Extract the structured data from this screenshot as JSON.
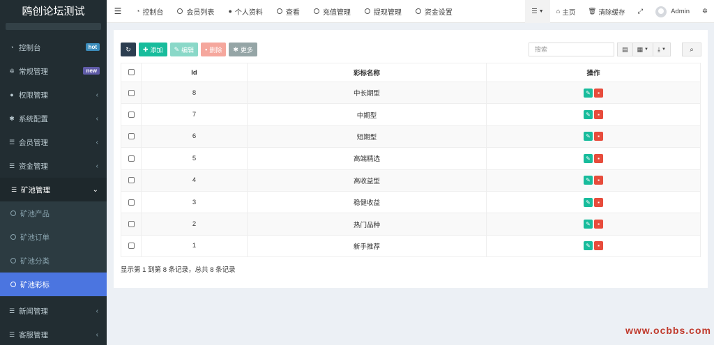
{
  "app": {
    "title": "鸥创论坛测试"
  },
  "sidebar": {
    "items": [
      {
        "label": "控制台",
        "icon": "dashboard-icon",
        "badge": "hot"
      },
      {
        "label": "常规管理",
        "icon": "cogs-icon",
        "badge": "new"
      },
      {
        "label": "权限管理",
        "icon": "group-icon",
        "arrow": "‹"
      },
      {
        "label": "系统配置",
        "icon": "gear-icon",
        "arrow": "‹"
      },
      {
        "label": "会员管理",
        "icon": "list-icon",
        "arrow": "‹"
      },
      {
        "label": "资金管理",
        "icon": "list-icon",
        "arrow": "‹"
      },
      {
        "label": "矿池管理",
        "icon": "list-icon",
        "arrow": "⌄"
      }
    ],
    "submenu": [
      {
        "label": "矿池产品"
      },
      {
        "label": "矿池订单"
      },
      {
        "label": "矿池分类"
      },
      {
        "label": "矿池彩标"
      }
    ],
    "items_after": [
      {
        "label": "新闻管理",
        "icon": "list-icon",
        "arrow": "‹"
      },
      {
        "label": "客服管理",
        "icon": "list-icon",
        "arrow": "‹"
      }
    ]
  },
  "topnav": {
    "tabs": [
      {
        "label": "控制台",
        "icon": "dashboard-icon"
      },
      {
        "label": "会员列表",
        "icon": "circle-icon"
      },
      {
        "label": "个人资料",
        "icon": "user-icon"
      },
      {
        "label": "查看",
        "icon": "circle-icon"
      },
      {
        "label": "充值管理",
        "icon": "circle-icon"
      },
      {
        "label": "提现管理",
        "icon": "circle-icon"
      },
      {
        "label": "资金设置",
        "icon": "circle-icon"
      }
    ],
    "home_label": "主页",
    "clear_cache_label": "清除缓存",
    "user_name": "Admin"
  },
  "toolbar": {
    "add_label": "添加",
    "edit_label": "编辑",
    "delete_label": "删除",
    "more_label": "更多",
    "search_placeholder": "搜索"
  },
  "table": {
    "headers": {
      "id": "Id",
      "name": "彩标名称",
      "ops": "操作"
    },
    "rows": [
      {
        "id": "8",
        "name": "中长期型"
      },
      {
        "id": "7",
        "name": "中期型"
      },
      {
        "id": "6",
        "name": "短期型"
      },
      {
        "id": "5",
        "name": "高端精选"
      },
      {
        "id": "4",
        "name": "高收益型"
      },
      {
        "id": "3",
        "name": "稳健收益"
      },
      {
        "id": "2",
        "name": "热门品种"
      },
      {
        "id": "1",
        "name": "新手推荐"
      }
    ],
    "summary": "显示第 1 到第 8 条记录，总共 8 条记录"
  },
  "watermark": "www.ocbbs.com",
  "colors": {
    "sidebar_bg": "#222d32",
    "active_item": "#4b75e0",
    "success": "#18bc9c",
    "danger": "#e74c3c",
    "watermark": "#c0392b"
  }
}
